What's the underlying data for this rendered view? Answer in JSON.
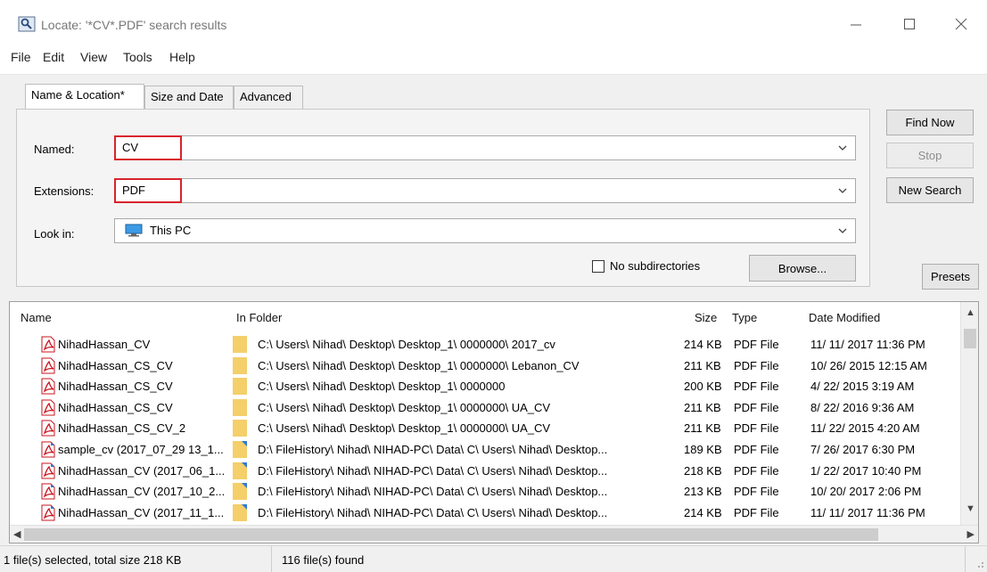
{
  "window": {
    "title": "Locate: '*CV*.PDF' search results"
  },
  "menu": [
    "File",
    "Edit",
    "View",
    "Tools",
    "Help"
  ],
  "tabs": [
    "Name & Location*",
    "Size and Date",
    "Advanced"
  ],
  "form": {
    "named_label": "Named:",
    "named_value": "CV",
    "extensions_label": "Extensions:",
    "extensions_value": "PDF",
    "lookin_label": "Look in:",
    "lookin_value": "This PC",
    "no_subdirs_label": "No subdirectories",
    "no_subdirs_checked": false,
    "browse_label": "Browse..."
  },
  "buttons": {
    "find_now": "Find Now",
    "stop": "Stop",
    "new_search": "New Search",
    "presets": "Presets"
  },
  "results": {
    "columns": {
      "name": "Name",
      "folder": "In Folder",
      "size": "Size",
      "type": "Type",
      "date": "Date Modified"
    },
    "rows": [
      {
        "name": "NihadHassan_CV",
        "folder": "C:\\ Users\\ Nihad\\ Desktop\\ Desktop_1\\ 0000000\\ 2017_cv",
        "size": "214 KB",
        "type": "PDF File",
        "date": "11/ 11/ 2017 11:36 PM",
        "icon": "pdf-icon"
      },
      {
        "name": "NihadHassan_CS_CV",
        "folder": "C:\\ Users\\ Nihad\\ Desktop\\ Desktop_1\\ 0000000\\ Lebanon_CV",
        "size": "211 KB",
        "type": "PDF File",
        "date": "10/ 26/ 2015 12:15 AM",
        "icon": "pdf-icon"
      },
      {
        "name": "NihadHassan_CS_CV",
        "folder": "C:\\ Users\\ Nihad\\ Desktop\\ Desktop_1\\ 0000000",
        "size": "200 KB",
        "type": "PDF File",
        "date": "4/ 22/ 2015 3:19 AM",
        "icon": "pdf-icon"
      },
      {
        "name": "NihadHassan_CS_CV",
        "folder": "C:\\ Users\\ Nihad\\ Desktop\\ Desktop_1\\ 0000000\\ UA_CV",
        "size": "211 KB",
        "type": "PDF File",
        "date": "8/ 22/ 2016 9:36 AM",
        "icon": "pdf-icon"
      },
      {
        "name": "NihadHassan_CS_CV_2",
        "folder": "C:\\ Users\\ Nihad\\ Desktop\\ Desktop_1\\ 0000000\\ UA_CV",
        "size": "211 KB",
        "type": "PDF File",
        "date": "11/ 22/ 2015 4:20 AM",
        "icon": "pdf-icon"
      },
      {
        "name": "sample_cv (2017_07_29 13_1...",
        "folder": "D:\\ FileHistory\\ Nihad\\ NIHAD-PC\\ Data\\ C\\ Users\\ Nihad\\ Desktop...",
        "size": "189 KB",
        "type": "PDF File",
        "date": "7/ 26/ 2017 6:30 PM",
        "icon": "pdf-history-icon"
      },
      {
        "name": "NihadHassan_CV (2017_06_1...",
        "folder": "D:\\ FileHistory\\ Nihad\\ NIHAD-PC\\ Data\\ C\\ Users\\ Nihad\\ Desktop...",
        "size": "218 KB",
        "type": "PDF File",
        "date": "1/ 22/ 2017 10:40 PM",
        "icon": "pdf-history-icon"
      },
      {
        "name": "NihadHassan_CV (2017_10_2...",
        "folder": "D:\\ FileHistory\\ Nihad\\ NIHAD-PC\\ Data\\ C\\ Users\\ Nihad\\ Desktop...",
        "size": "213 KB",
        "type": "PDF File",
        "date": "10/ 20/ 2017 2:06 PM",
        "icon": "pdf-history-icon"
      },
      {
        "name": "NihadHassan_CV (2017_11_1...",
        "folder": "D:\\ FileHistory\\ Nihad\\ NIHAD-PC\\ Data\\ C\\ Users\\ Nihad\\ Desktop...",
        "size": "214 KB",
        "type": "PDF File",
        "date": "11/ 11/ 2017 11:36 PM",
        "icon": "pdf-history-icon"
      }
    ]
  },
  "status": {
    "selection": "1 file(s) selected, total size 218 KB",
    "found": "116 file(s) found"
  },
  "colors": {
    "highlight_border": "#d8242c",
    "pdf_red": "#c9151e",
    "folder_yellow": "#f4cf6a"
  }
}
